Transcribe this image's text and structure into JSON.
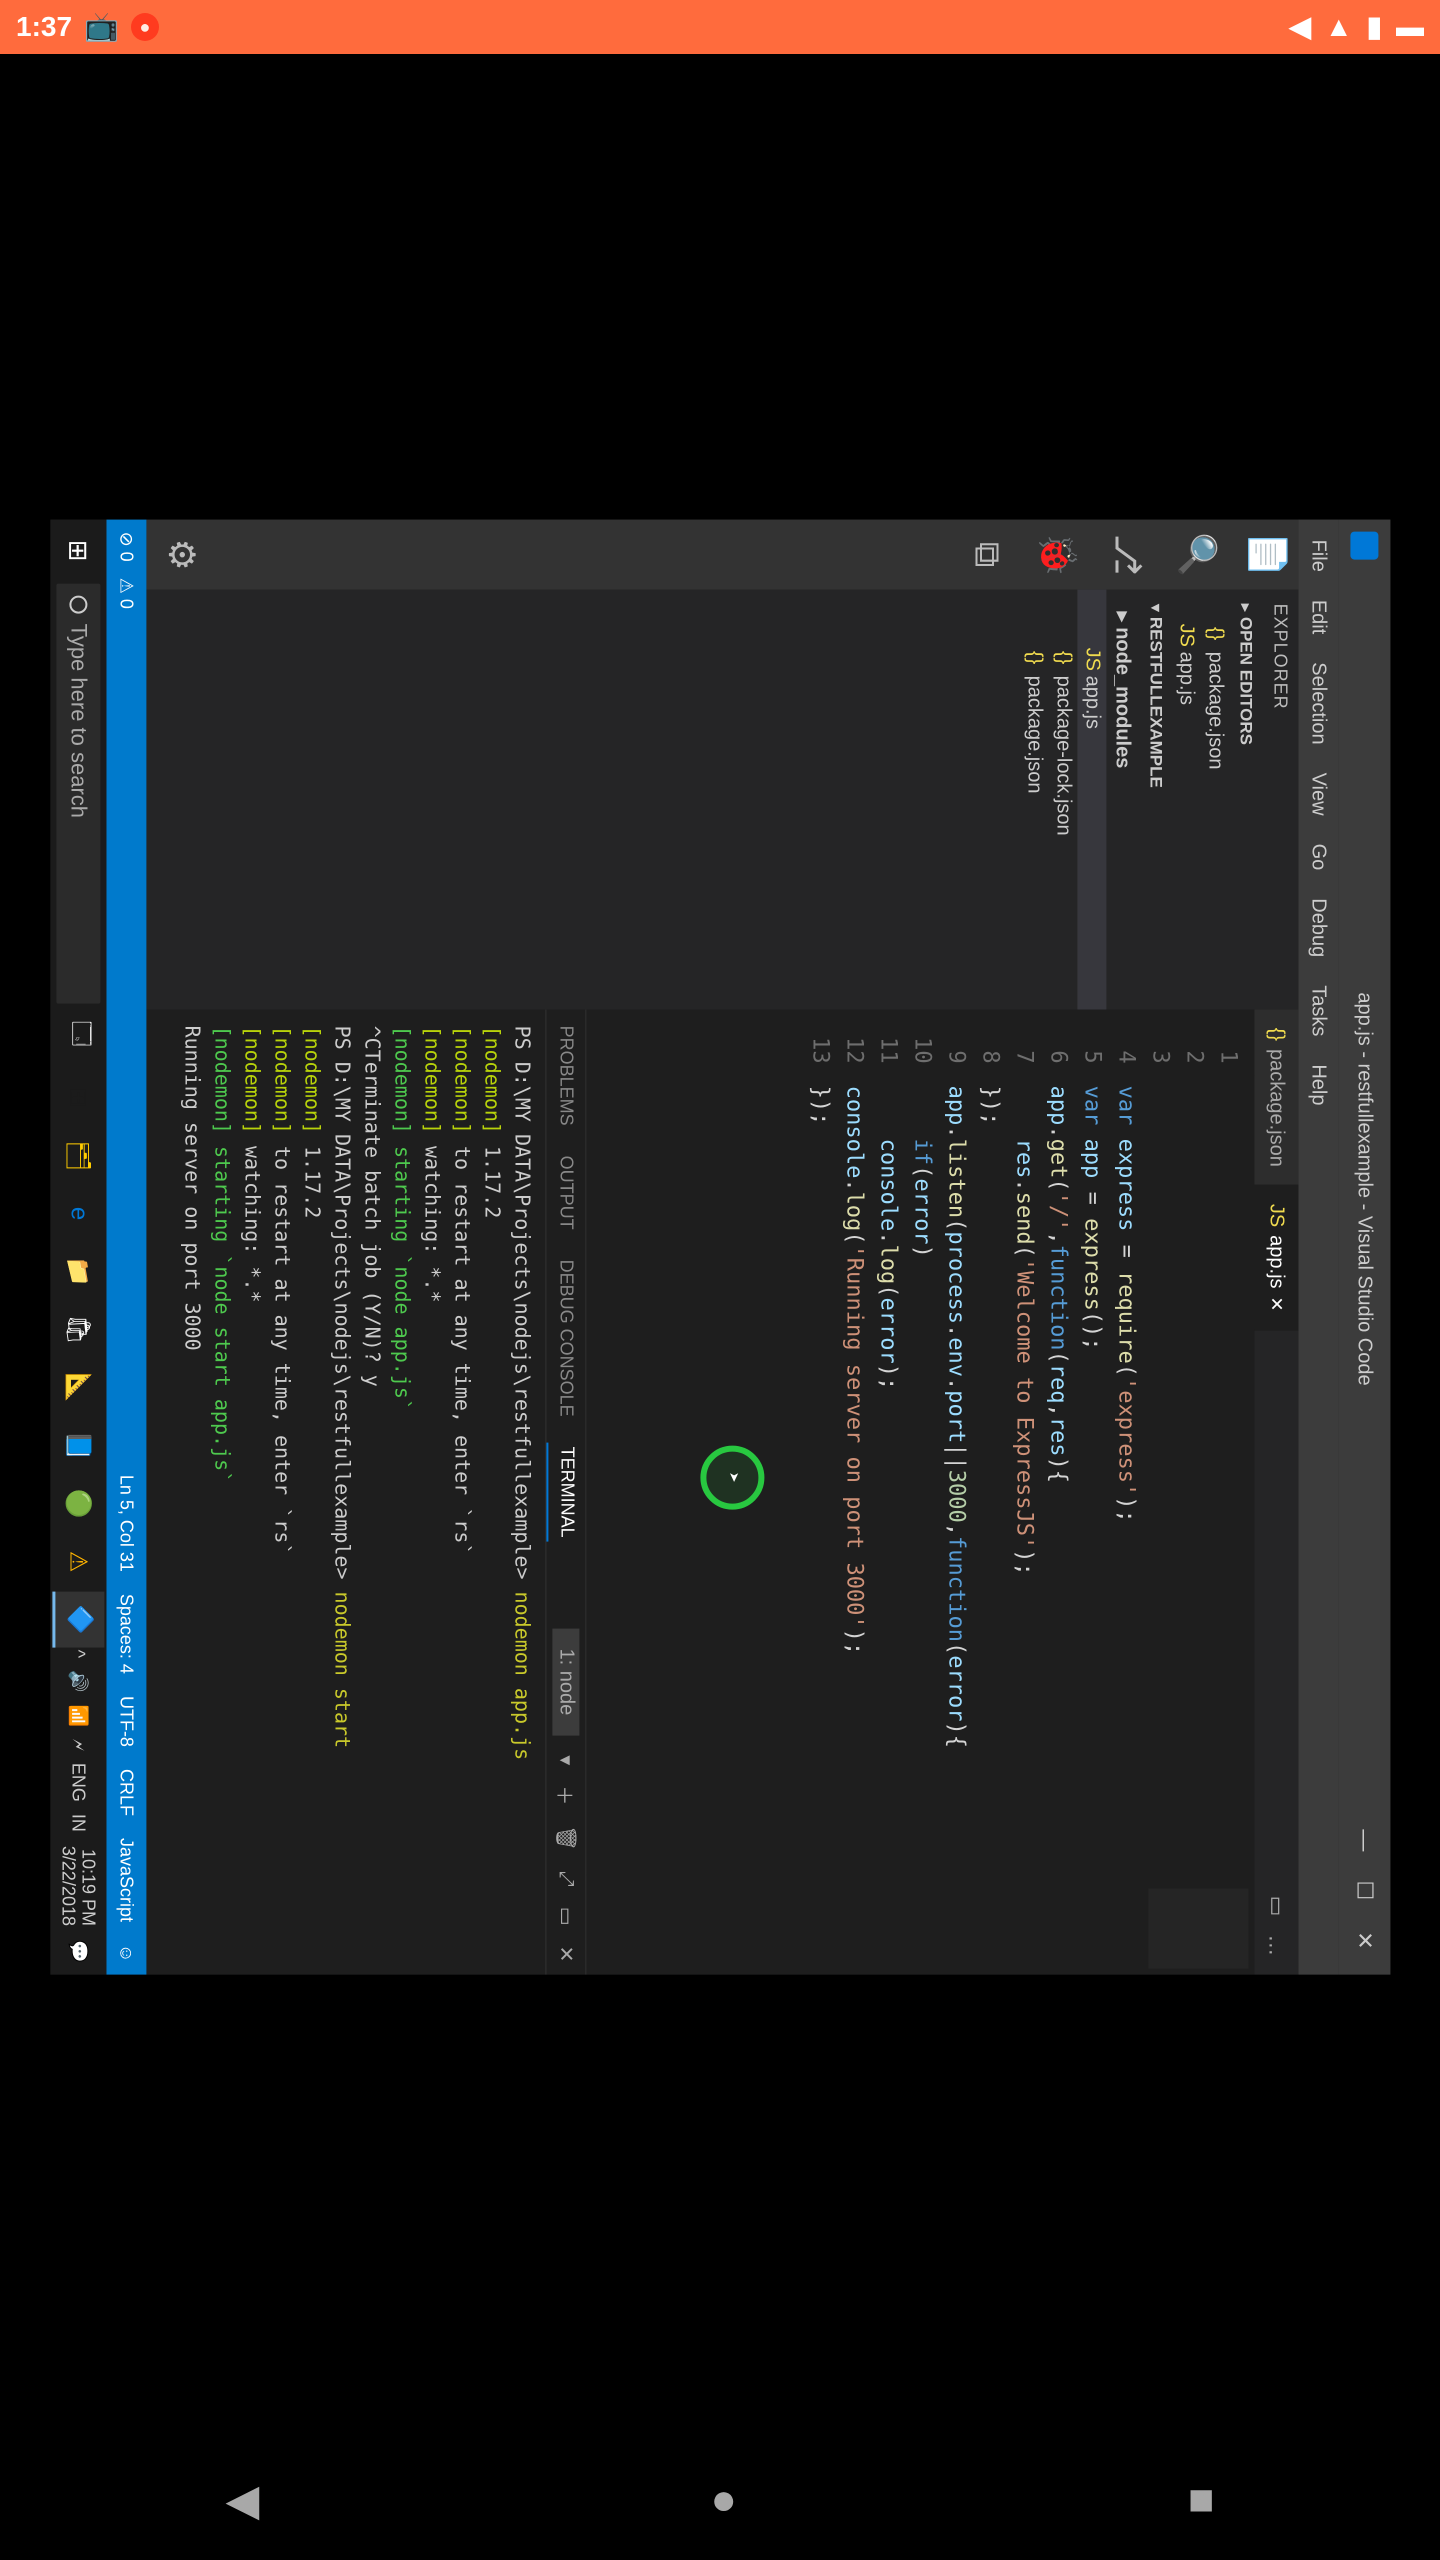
{
  "android": {
    "time": "1:37",
    "nav": {
      "back": "◀",
      "home": "●",
      "recent": "■"
    }
  },
  "vscode": {
    "title": "app.js - restfullexample - Visual Studio Code",
    "window_btns": {
      "min": "—",
      "max": "☐",
      "close": "✕"
    },
    "menu": [
      "File",
      "Edit",
      "Selection",
      "View",
      "Go",
      "Debug",
      "Tasks",
      "Help"
    ],
    "activity": [
      "📄",
      "🔍",
      "⎇",
      "🐞",
      "⧉",
      "⚙"
    ],
    "explorer": {
      "header": "EXPLORER",
      "open_editors": "OPEN EDITORS",
      "project": "RESTFULLEXAMPLE",
      "items": [
        {
          "icon": "{}",
          "cls": "ic-json",
          "name": "package.json"
        },
        {
          "icon": "JS",
          "cls": "ic-js",
          "name": "app.js"
        }
      ],
      "tree": [
        {
          "type": "folder",
          "name": "node_modules"
        },
        {
          "type": "file",
          "icon": "JS",
          "cls": "ic-js",
          "name": "app.js",
          "active": true
        },
        {
          "type": "file",
          "icon": "{}",
          "cls": "ic-json",
          "name": "package-lock.json"
        },
        {
          "type": "file",
          "icon": "{}",
          "cls": "ic-json",
          "name": "package.json"
        }
      ]
    },
    "tabs": [
      {
        "icon": "{}",
        "label": "package.json",
        "active": false
      },
      {
        "icon": "JS",
        "label": "app.js",
        "active": true,
        "close": "✕"
      }
    ],
    "tabs_toolbar": [
      "▭",
      "…"
    ],
    "line_numbers": [
      "1",
      "2",
      "3",
      "4",
      "5",
      "6",
      "7",
      "8",
      "9",
      "10",
      "11",
      "12",
      "13"
    ],
    "code_lines": [
      [
        [
          "kw",
          "var"
        ],
        [
          "pl",
          " "
        ],
        [
          "var",
          "express"
        ],
        [
          "pl",
          " "
        ],
        [
          "op",
          "="
        ],
        [
          "pl",
          " "
        ],
        [
          "fn",
          "require"
        ],
        [
          "op",
          "("
        ],
        [
          "str",
          "'express'"
        ],
        [
          "op",
          ");"
        ]
      ],
      [
        [
          "kw",
          "var"
        ],
        [
          "pl",
          " "
        ],
        [
          "var",
          "app"
        ],
        [
          "pl",
          " "
        ],
        [
          "op",
          "="
        ],
        [
          "pl",
          " "
        ],
        [
          "fn",
          "express"
        ],
        [
          "op",
          "();"
        ]
      ],
      [
        [
          "pl",
          ""
        ]
      ],
      [
        [
          "var",
          "app"
        ],
        [
          "op",
          "."
        ],
        [
          "fn",
          "get"
        ],
        [
          "op",
          "("
        ],
        [
          "str",
          "'/'"
        ],
        [
          "op",
          ","
        ],
        [
          "kw",
          "function"
        ],
        [
          "op",
          "("
        ],
        [
          "var",
          "req"
        ],
        [
          "op",
          ","
        ],
        [
          "var",
          "res"
        ],
        [
          "op",
          "){"
        ]
      ],
      [
        [
          "pl",
          "    "
        ],
        [
          "var",
          "res"
        ],
        [
          "op",
          "."
        ],
        [
          "fn",
          "send"
        ],
        [
          "op",
          "("
        ],
        [
          "str",
          "'Welcome to ExpressJS'"
        ],
        [
          "op",
          ");"
        ]
      ],
      [
        [
          "op",
          "});"
        ]
      ],
      [
        [
          "pl",
          ""
        ]
      ],
      [
        [
          "var",
          "app"
        ],
        [
          "op",
          "."
        ],
        [
          "fn",
          "listen"
        ],
        [
          "op",
          "("
        ],
        [
          "var",
          "process"
        ],
        [
          "op",
          "."
        ],
        [
          "prop",
          "env"
        ],
        [
          "op",
          "."
        ],
        [
          "prop",
          "port"
        ],
        [
          "op",
          "||"
        ],
        [
          "num",
          "3000"
        ],
        [
          "op",
          ","
        ],
        [
          "kw",
          "function"
        ],
        [
          "op",
          "("
        ],
        [
          "var",
          "error"
        ],
        [
          "op",
          "){"
        ]
      ],
      [
        [
          "pl",
          "    "
        ],
        [
          "kw",
          "if"
        ],
        [
          "op",
          "("
        ],
        [
          "var",
          "error"
        ],
        [
          "op",
          ")"
        ]
      ],
      [
        [
          "pl",
          "    "
        ],
        [
          "var",
          "console"
        ],
        [
          "op",
          "."
        ],
        [
          "fn",
          "log"
        ],
        [
          "op",
          "("
        ],
        [
          "var",
          "error"
        ],
        [
          "op",
          ");"
        ]
      ],
      [
        [
          "pl",
          ""
        ]
      ],
      [
        [
          "var",
          "console"
        ],
        [
          "op",
          "."
        ],
        [
          "fn",
          "log"
        ],
        [
          "op",
          "("
        ],
        [
          "str",
          "'Running server on port 3000'"
        ],
        [
          "op",
          ");"
        ]
      ],
      [
        [
          "op",
          "});"
        ]
      ]
    ],
    "panel": {
      "tabs": [
        "PROBLEMS",
        "OUTPUT",
        "DEBUG CONSOLE",
        "TERMINAL"
      ],
      "active_tab": "TERMINAL",
      "selector": "1: node",
      "tools": [
        "▾",
        "＋",
        "🗑",
        "⤢",
        "▭",
        "✕"
      ],
      "lines": [
        {
          "segs": [
            [
              "path",
              "PS D:\\MY DATA\\Projects\\nodejs\\restfullexample> "
            ],
            [
              "cmd",
              "nodemon app.js"
            ]
          ]
        },
        {
          "segs": [
            [
              "nm",
              "[nodemon]"
            ],
            [
              "path",
              " 1.17.2"
            ]
          ]
        },
        {
          "segs": [
            [
              "nm",
              "[nodemon]"
            ],
            [
              "path",
              " to restart at any time, enter `rs`"
            ]
          ]
        },
        {
          "segs": [
            [
              "nm",
              "[nodemon]"
            ],
            [
              "path",
              " watching: *.*"
            ]
          ]
        },
        {
          "segs": [
            [
              "run",
              "[nodemon]"
            ],
            [
              "run",
              " starting `node app.js`"
            ]
          ]
        },
        {
          "segs": [
            [
              "path",
              "^CTerminate batch job (Y/N)? y"
            ]
          ]
        },
        {
          "segs": [
            [
              "path",
              "PS D:\\MY DATA\\Projects\\nodejs\\restfullexample> "
            ],
            [
              "cmd",
              "nodemon start"
            ]
          ]
        },
        {
          "segs": [
            [
              "nm",
              "[nodemon]"
            ],
            [
              "path",
              " 1.17.2"
            ]
          ]
        },
        {
          "segs": [
            [
              "nm",
              "[nodemon]"
            ],
            [
              "path",
              " to restart at any time, enter `rs`"
            ]
          ]
        },
        {
          "segs": [
            [
              "nm",
              "[nodemon]"
            ],
            [
              "path",
              " watching: *.*"
            ]
          ]
        },
        {
          "segs": [
            [
              "run",
              "[nodemon]"
            ],
            [
              "run",
              " starting `node start app.js`"
            ]
          ]
        },
        {
          "segs": [
            [
              "path",
              "Running server on port 3000"
            ]
          ]
        }
      ]
    },
    "status": {
      "left": [
        "⊘ 0",
        "⚠ 0"
      ],
      "right": [
        "Ln 5, Col 31",
        "Spaces: 4",
        "UTF-8",
        "CRLF",
        "JavaScript",
        "☺"
      ]
    }
  },
  "wintask": {
    "search_placeholder": "Type here to search",
    "apps": [
      "⊞",
      "🗂",
      "e",
      "📁",
      "🛍",
      "📐",
      "📘",
      "🟢",
      "⚠",
      "🔷"
    ],
    "tray": [
      "^",
      "🔊",
      "📶",
      "🗲",
      "ENG",
      "IN"
    ],
    "time": "10:19 PM",
    "date": "3/22/2018"
  }
}
